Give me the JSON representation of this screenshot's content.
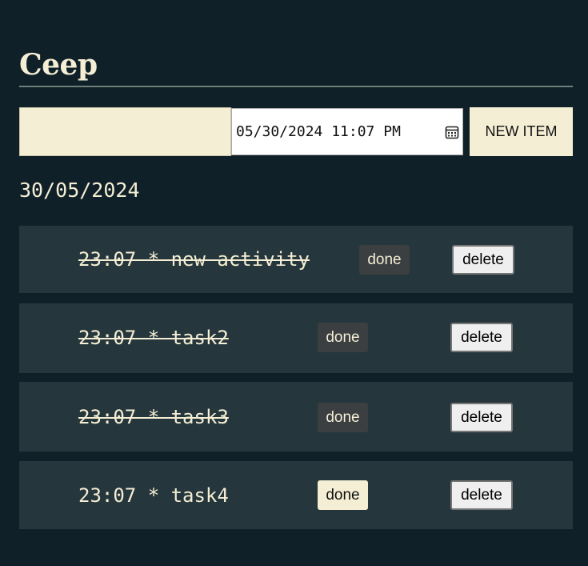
{
  "app": {
    "title": "Ceep"
  },
  "form": {
    "text_value": "",
    "datetime_display": "05/30/2024 11:07 PM",
    "new_item_label": "NEW ITEM"
  },
  "date_heading": "30/05/2024",
  "tasks": [
    {
      "label": "23:07 * new activity",
      "completed": true,
      "done_label": "done",
      "delete_label": "delete"
    },
    {
      "label": "23:07 * task2",
      "completed": true,
      "done_label": "done",
      "delete_label": "delete"
    },
    {
      "label": "23:07 * task3",
      "completed": true,
      "done_label": "done",
      "delete_label": "delete"
    },
    {
      "label": "23:07 * task4",
      "completed": false,
      "done_label": "done",
      "delete_label": "delete"
    }
  ],
  "icons": {
    "date_picker": "calendar-icon"
  },
  "colors": {
    "background": "#0f2028",
    "card": "#25363c",
    "cream": "#f4eed4",
    "done_inactive": "#3b3f41"
  }
}
